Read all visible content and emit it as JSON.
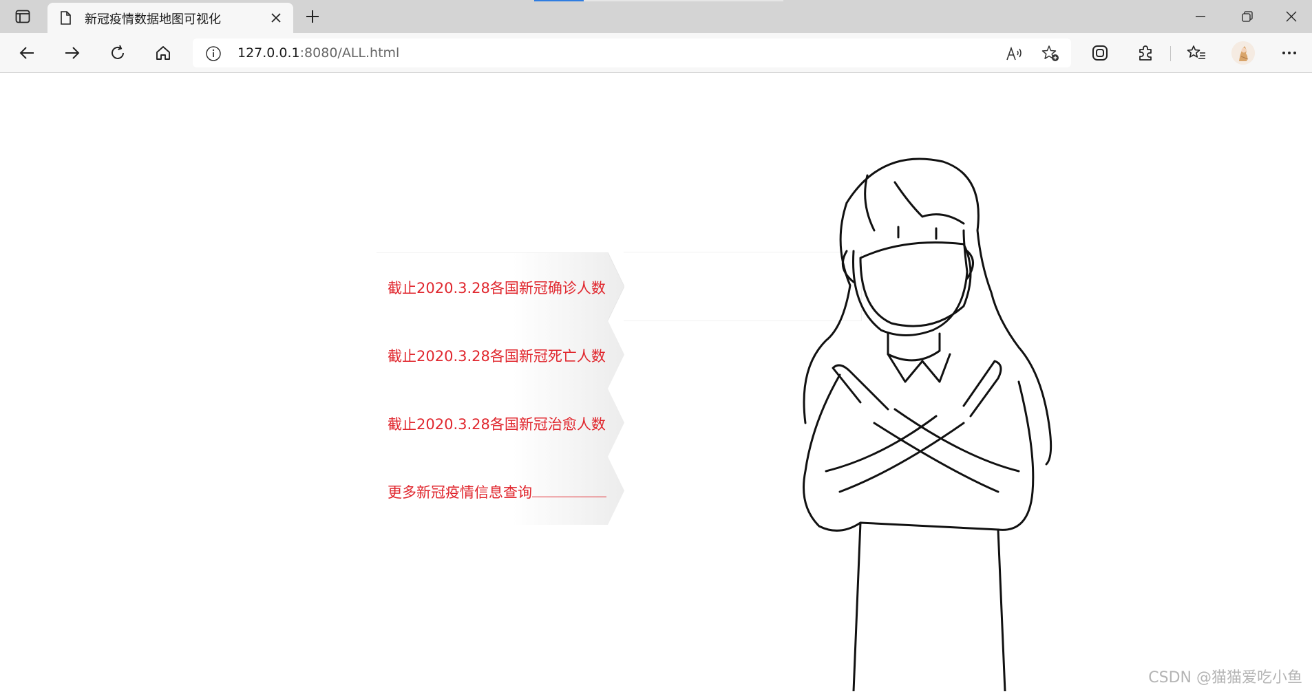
{
  "browser": {
    "tab": {
      "title": "新冠疫情数据地图可视化",
      "favicon": "page-icon"
    },
    "address": {
      "url_host": "127.0.0.1",
      "url_rest": ":8080/ALL.html"
    },
    "icons": {
      "tab_actions": "tab-actions-icon",
      "close_tab": "close-icon",
      "new_tab": "plus-icon",
      "back": "back-arrow-icon",
      "forward": "forward-arrow-icon",
      "refresh": "refresh-icon",
      "home": "home-icon",
      "site_info": "info-icon",
      "read_aloud": "read-aloud-icon",
      "add_favorite": "add-favorite-icon",
      "collections": "collections-icon",
      "extensions": "puzzle-icon",
      "favorites": "favorites-icon",
      "more": "more-icon"
    }
  },
  "page": {
    "menu": [
      {
        "label": "截止2020.3.28各国新冠确诊人数"
      },
      {
        "label": "截止2020.3.28各国新冠死亡人数"
      },
      {
        "label": "截止2020.3.28各国新冠治愈人数"
      },
      {
        "label": "更多新冠疫情信息查询"
      }
    ],
    "accent_color": "#e0262d",
    "illustration": "masked-girl-crossed-arms"
  },
  "watermark": "CSDN @猫猫爱吃小鱼"
}
